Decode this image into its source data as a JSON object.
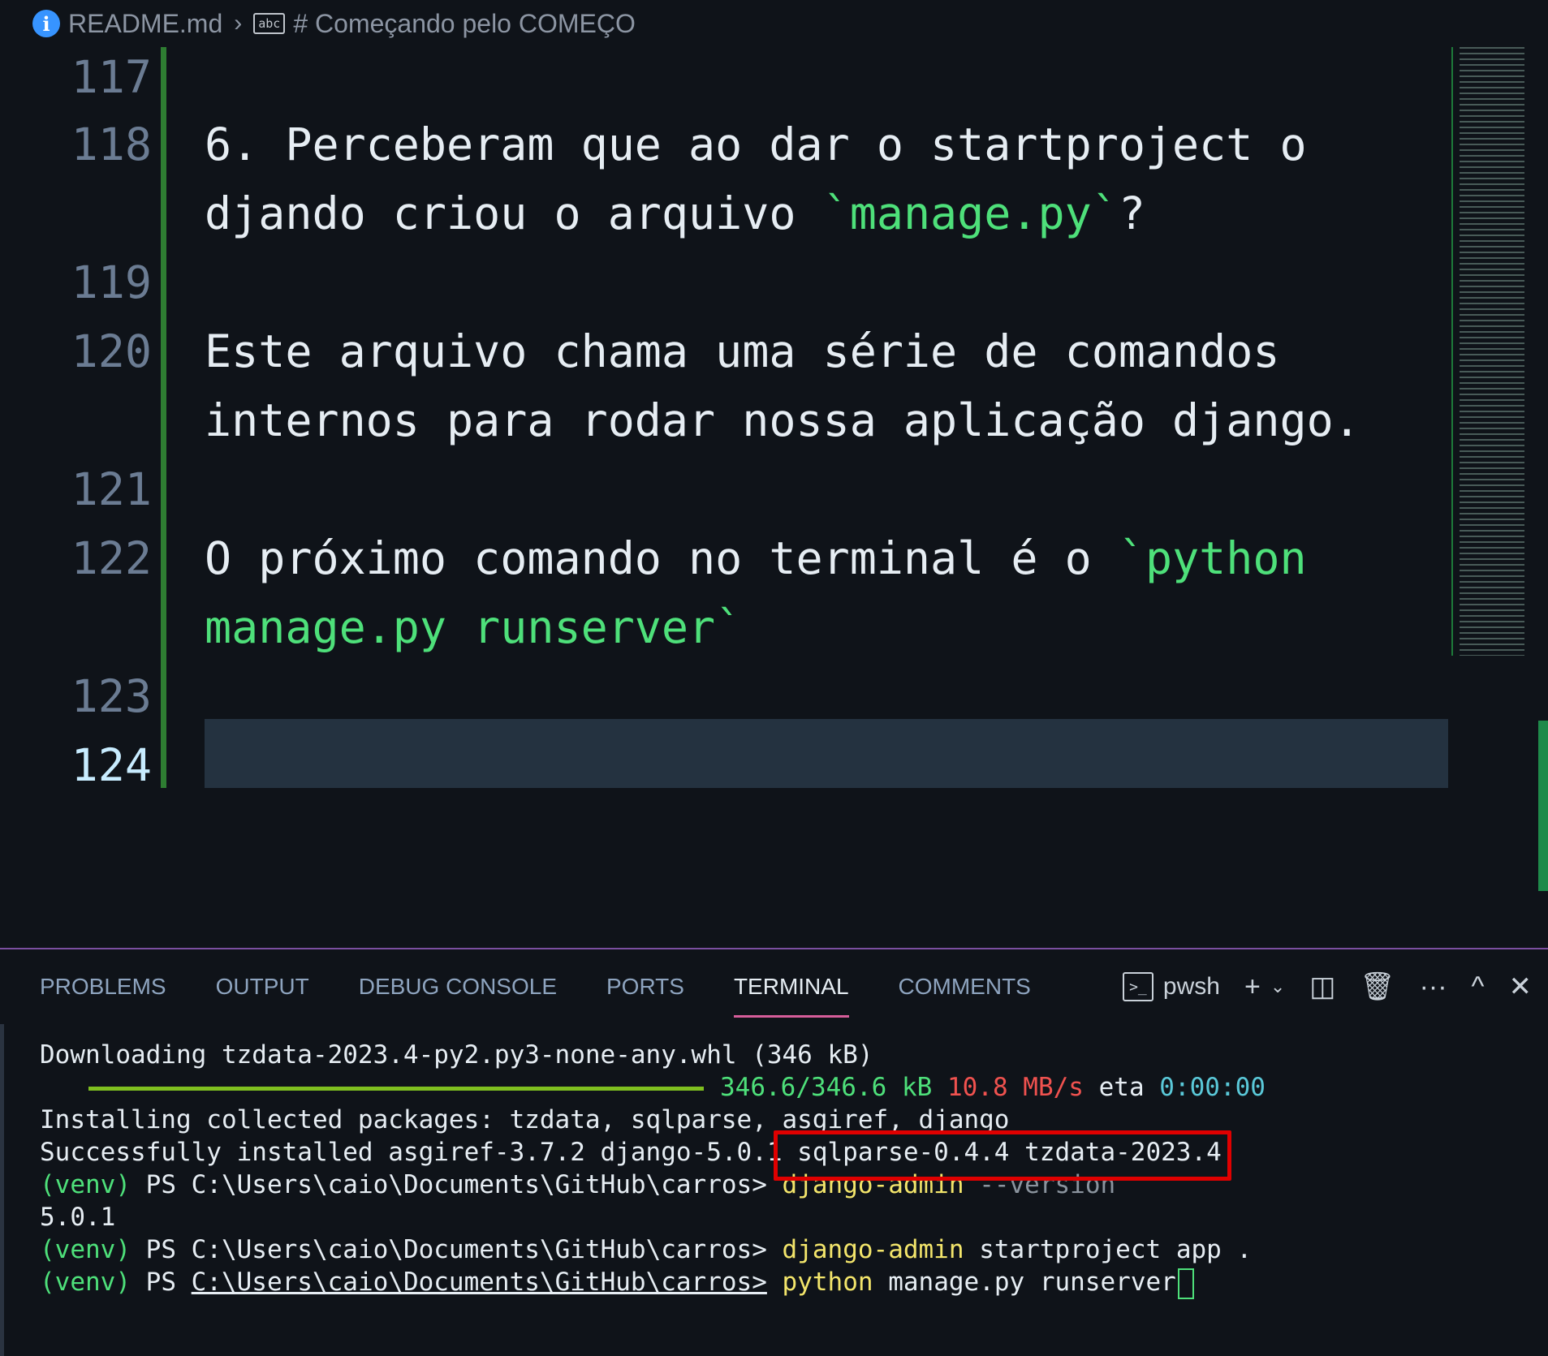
{
  "breadcrumb": {
    "file": "README.md",
    "section": "# Começando pelo COMEÇO"
  },
  "editor": {
    "lines": [
      {
        "num": "117",
        "text": ""
      },
      {
        "num": "118",
        "text_parts": [
          "6. Perceberam que ao dar o startproject o",
          "djando criou o arquivo ",
          "`manage.py`",
          "?"
        ]
      },
      {
        "num": "119",
        "text": ""
      },
      {
        "num": "120",
        "text_parts": [
          "Este arquivo chama uma série de comandos",
          "internos para rodar nossa aplicação django."
        ]
      },
      {
        "num": "121",
        "text": ""
      },
      {
        "num": "122",
        "text_parts": [
          "O próximo comando no terminal é o ",
          "`python",
          "manage.py runserver`"
        ]
      },
      {
        "num": "123",
        "text": ""
      },
      {
        "num": "124",
        "text": ""
      }
    ]
  },
  "panel": {
    "tabs": [
      "PROBLEMS",
      "OUTPUT",
      "DEBUG CONSOLE",
      "PORTS",
      "TERMINAL",
      "COMMENTS"
    ],
    "active_tab": "TERMINAL",
    "shell": "pwsh"
  },
  "terminal": {
    "download": "Downloading tzdata-2023.4-py2.py3-none-any.whl (346 kB)",
    "progress": {
      "fraction": 1.0,
      "size": "346.6/346.6 kB",
      "speed": "10.8 MB/s",
      "eta_label": "eta",
      "eta": "0:00:00"
    },
    "installing": "Installing collected packages: tzdata, sqlparse, asgiref, django",
    "installed": "Successfully installed asgiref-3.7.2 django-5.0.1 sqlparse-0.4.4 tzdata-2023.4",
    "venv": "(venv)",
    "ps": "PS",
    "path": "C:\\Users\\caio\\Documents\\GitHub\\carros>",
    "cmd1": "django-admin",
    "cmd1_args": "--version",
    "version_output": "5.0.1",
    "cmd2": "django-admin",
    "cmd2_args": "startproject app .",
    "cmd3": "python",
    "cmd3_args": "manage.py runserver"
  },
  "colors": {
    "accent_green": "#4ee07a",
    "highlight_red": "#e00000",
    "active_tab_underline": "#d65d9a"
  }
}
